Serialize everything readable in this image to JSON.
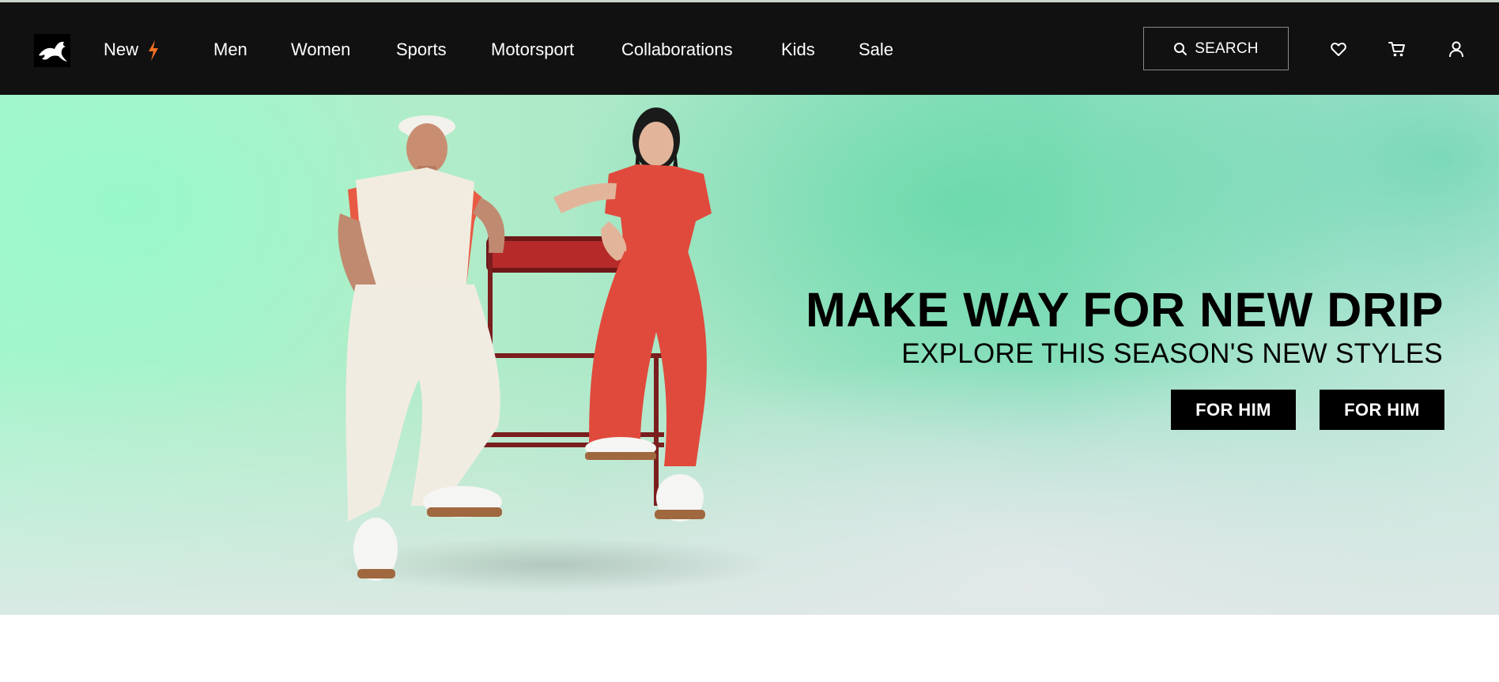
{
  "nav": {
    "logo_icon": "puma-cat-logo",
    "new_label": "New",
    "new_icon": "lightning-bolt-icon",
    "items": [
      "Men",
      "Women",
      "Sports",
      "Motorsport",
      "Collaborations",
      "Kids",
      "Sale"
    ],
    "search_label": "SEARCH",
    "icons": [
      "heart-icon",
      "cart-icon",
      "user-icon"
    ]
  },
  "hero": {
    "headline": "MAKE WAY FOR NEW DRIP",
    "subheadline": "EXPLORE THIS SEASON'S NEW STYLES",
    "cta_1": "FOR HIM",
    "cta_2": "FOR HIM"
  },
  "colors": {
    "nav_bg": "#111111",
    "accent_bolt": "#f37021",
    "hero_mint": "#a6f5cc",
    "cta_bg": "#000000",
    "outfit_red": "#e04a3c",
    "outfit_cream": "#f1ece2"
  }
}
